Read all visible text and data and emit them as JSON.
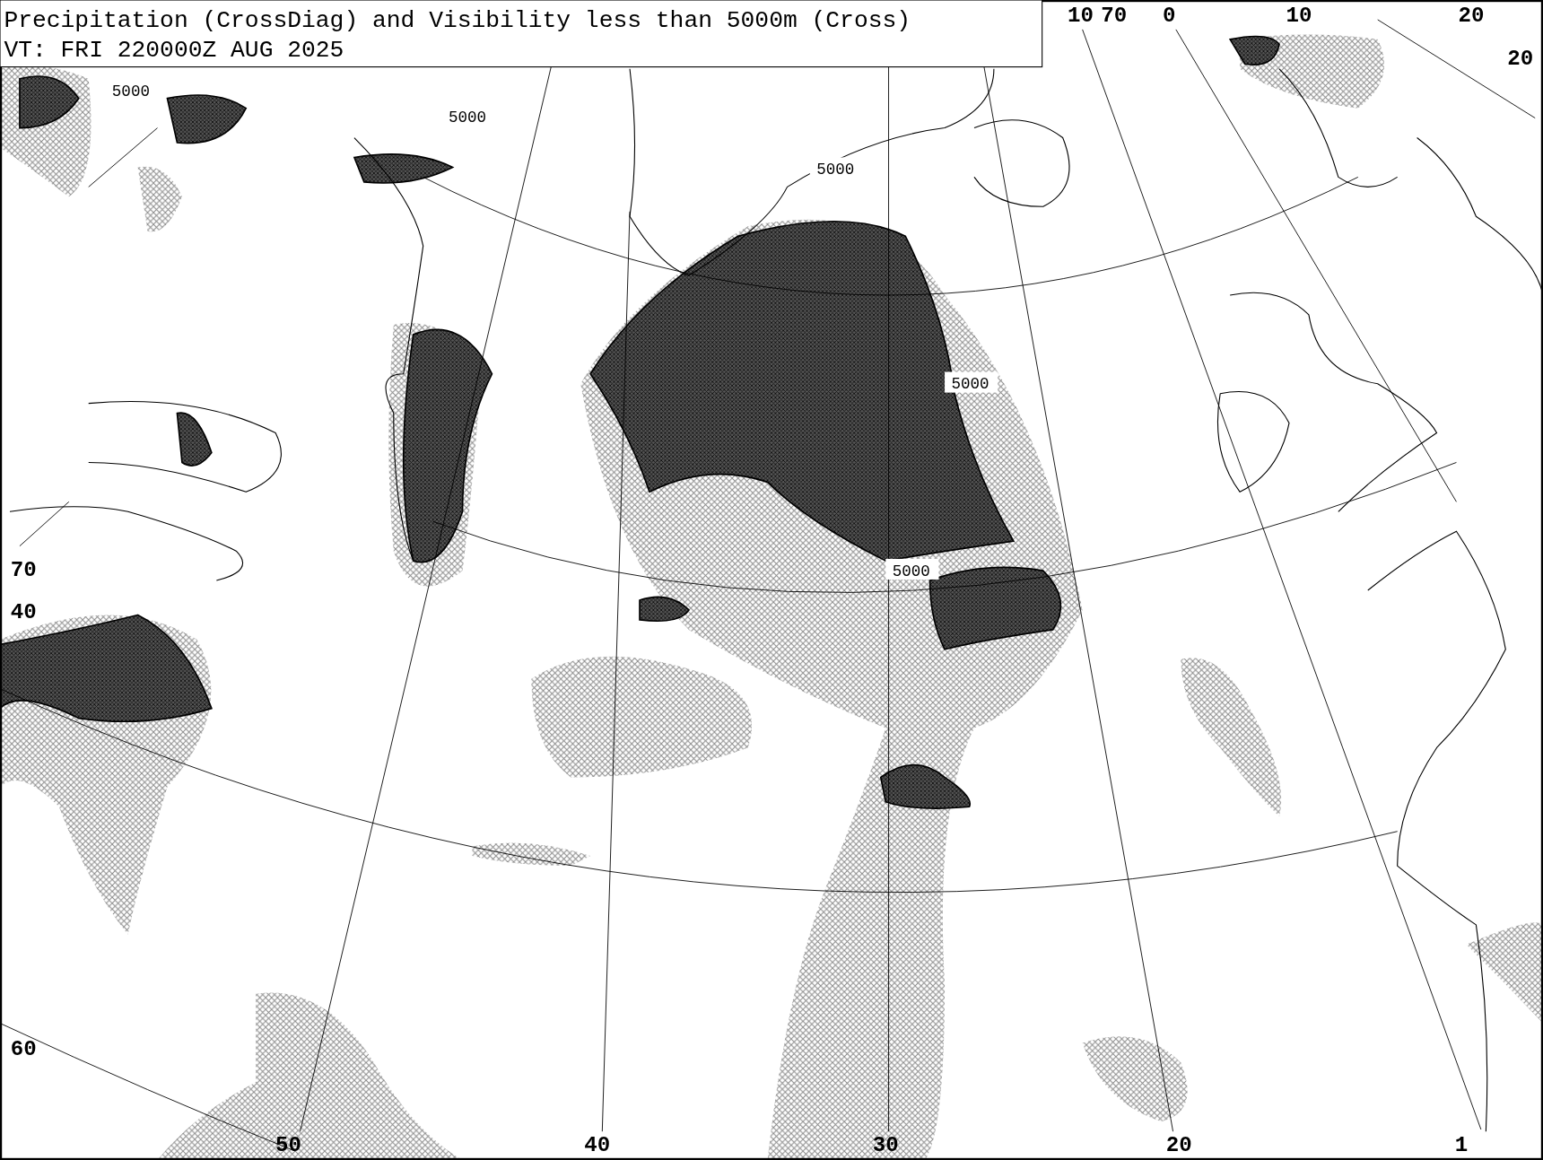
{
  "title": {
    "line_1": "Precipitation (CrossDiag) and Visibility less than 5000m (Cross)",
    "line_2": "VT: FRI 220000Z AUG 2025"
  },
  "grid_labels": [
    "10",
    "70",
    "0",
    "10",
    "20",
    "20",
    "70",
    "40",
    "60",
    "50",
    "40",
    "30",
    "20",
    "1"
  ],
  "contour_labels": [
    "5000",
    "5000",
    "5000",
    "5000",
    "5000"
  ]
}
